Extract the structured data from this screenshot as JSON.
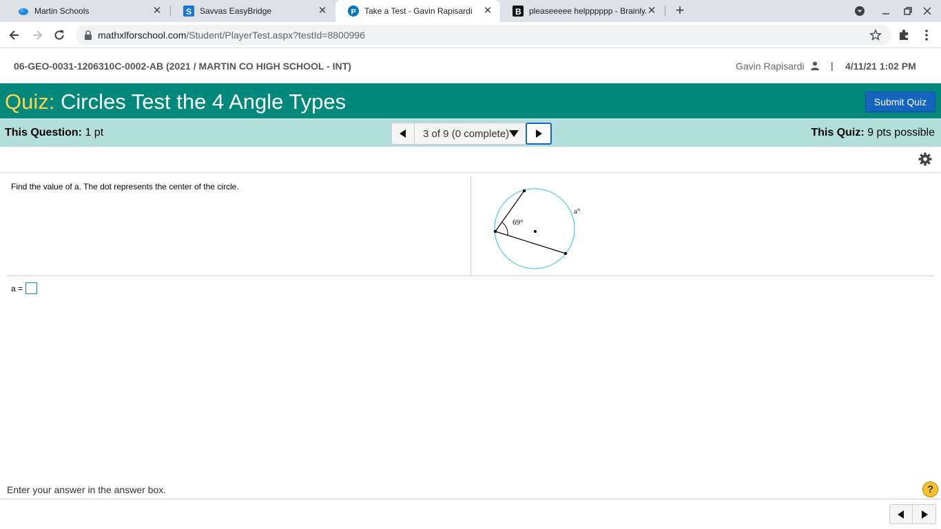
{
  "browser": {
    "tabs": [
      {
        "title": "Martin Schools",
        "icon": "cloud-icon"
      },
      {
        "title": "Savvas EasyBridge",
        "icon": "savvas-icon"
      },
      {
        "title": "Take a Test - Gavin Rapisardi",
        "icon": "pearson-icon"
      },
      {
        "title": "pleaseeeee helpppppp - Brainly.c",
        "icon": "brainly-icon"
      }
    ],
    "new_tab": "+",
    "url_host": "mathxlforschool.com",
    "url_path": "/Student/PlayerTest.aspx?testId=8800996"
  },
  "header": {
    "course": "06-GEO-0031-1206310C-0002-AB (2021 / MARTIN CO HIGH SCHOOL - INT)",
    "user": "Gavin Rapisardi",
    "separator": "|",
    "datetime": "4/11/21 1:02 PM"
  },
  "quiz": {
    "label": "Quiz:",
    "title": "Circles Test the 4 Angle Types",
    "submit_label": "Submit Quiz"
  },
  "question_bar": {
    "this_question_label": "This Question:",
    "this_question_value": "1 pt",
    "navigator": "3 of 9 (0 complete)",
    "this_quiz_label": "This Quiz:",
    "this_quiz_value": "9 pts possible"
  },
  "question": {
    "prompt": "Find the value of a. The dot represents the center of the circle.",
    "figure_angle_label": "69°",
    "figure_arc_label": "a°",
    "answer_label": "a =",
    "answer_value": ""
  },
  "footer": {
    "hint": "Enter your answer in the answer box.",
    "help": "?"
  },
  "colors": {
    "quiz_bar": "#00897b",
    "quiz_label": "#ffd54f",
    "question_bar": "#b2dfdb",
    "submit_button": "#1565c0",
    "circle": "#26c6da"
  }
}
